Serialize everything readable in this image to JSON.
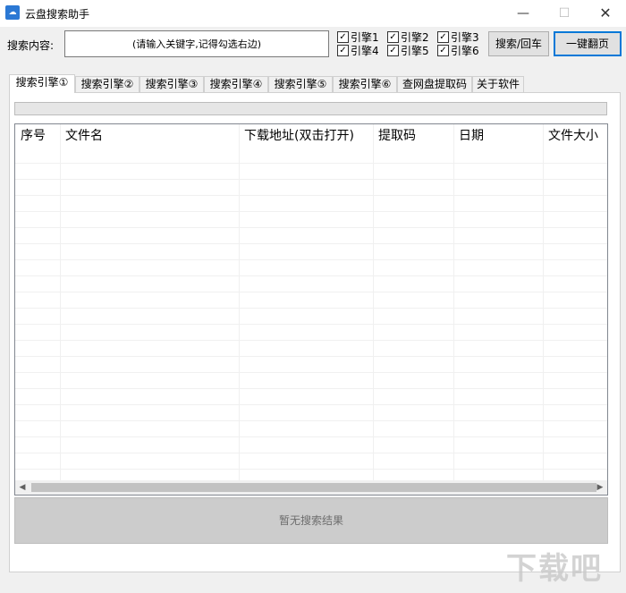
{
  "window": {
    "title": "云盘搜索助手",
    "icon": "cloud-icon",
    "minimize_glyph": "—",
    "maximize_glyph": "☐",
    "close_glyph": "✕"
  },
  "search": {
    "label": "搜索内容:",
    "placeholder": "(请输入关键字,记得勾选右边)",
    "value": ""
  },
  "engines": [
    {
      "label": "引擎1",
      "checked": true
    },
    {
      "label": "引擎2",
      "checked": true
    },
    {
      "label": "引擎3",
      "checked": true
    },
    {
      "label": "引擎4",
      "checked": true
    },
    {
      "label": "引擎5",
      "checked": true
    },
    {
      "label": "引擎6",
      "checked": true
    }
  ],
  "buttons": {
    "search": "搜索/回车",
    "next_page": "一键翻页"
  },
  "tabs": [
    {
      "label": "搜索引擎①",
      "active": true
    },
    {
      "label": "搜索引擎②"
    },
    {
      "label": "搜索引擎③"
    },
    {
      "label": "搜索引擎④"
    },
    {
      "label": "搜索引擎⑤"
    },
    {
      "label": "搜索引擎⑥"
    },
    {
      "label": "查网盘提取码"
    },
    {
      "label": "关于软件"
    }
  ],
  "progress": {
    "percent": 0
  },
  "table": {
    "columns": [
      "序号",
      "文件名",
      "下载地址(双击打开)",
      "提取码",
      "日期",
      "文件大小"
    ],
    "rows": []
  },
  "status": {
    "text": "暂无搜索结果"
  },
  "watermark": "下载吧",
  "colors": {
    "accent": "#0078d7",
    "result_bar": "#cccccc"
  }
}
